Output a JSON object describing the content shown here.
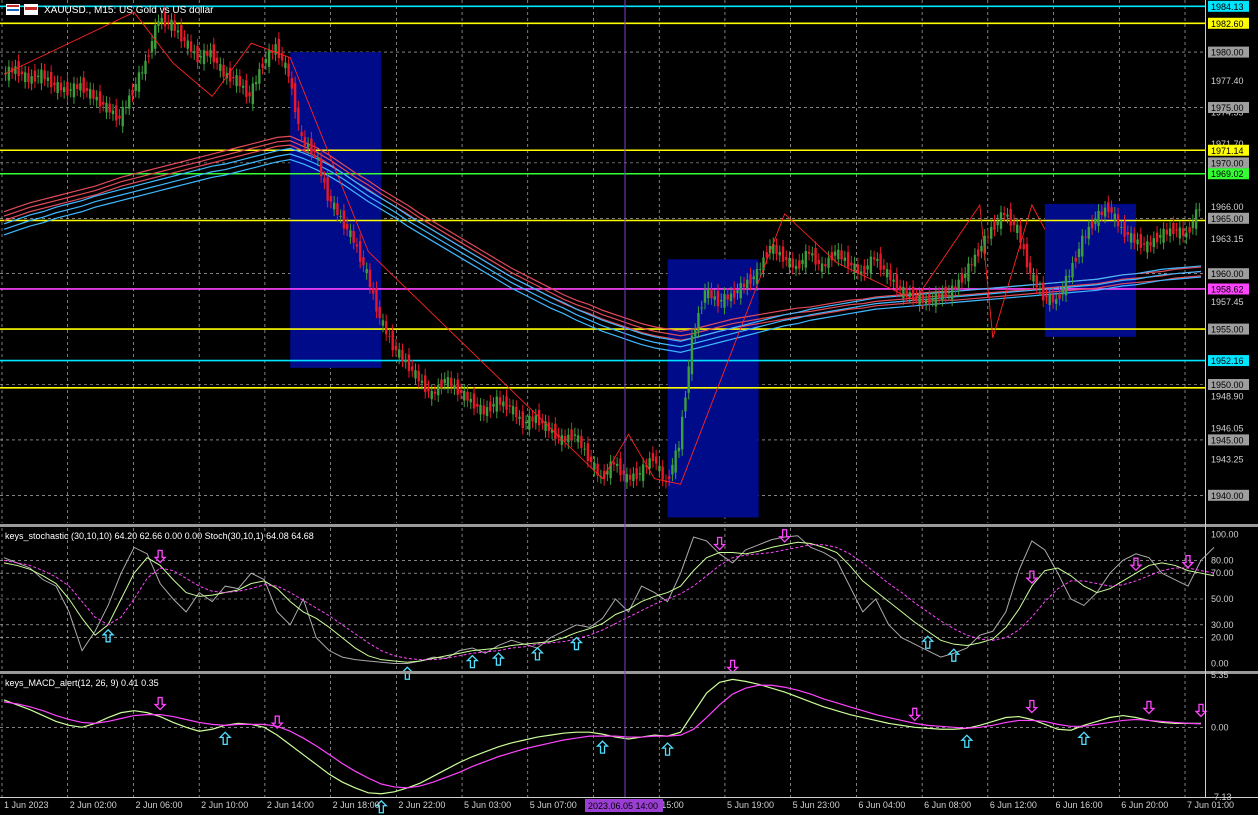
{
  "header": {
    "symbol_title": "XAUUSD., M15: US Gold vs US dollar"
  },
  "chart_data": [
    {
      "type": "candlestick",
      "title": "XAUUSD., M15: US Gold vs US dollar",
      "ylim": [
        1937.5,
        1984.7
      ],
      "price_axis_ticks": [
        "1980.00",
        "1977.40",
        "1975.00",
        "1974.55",
        "1971.70",
        "1970.00",
        "1966.00",
        "1963.15",
        "1960.00",
        "1957.45",
        "1955.00",
        "1948.90",
        "1946.05",
        "1945.00",
        "1943.25",
        "1940.00"
      ],
      "highlighted_levels": [
        {
          "label": "1984.13",
          "value": 1984.13,
          "color": "#00e5ff"
        },
        {
          "label": "1982.60",
          "value": 1982.6,
          "color": "#ffff00"
        },
        {
          "label": "1980.00",
          "value": 1980.0,
          "color": "#9e9e9e"
        },
        {
          "label": "1975.00",
          "value": 1975.0,
          "color": "#9e9e9e"
        },
        {
          "label": "1971.14",
          "value": 1971.14,
          "color": "#ffff00"
        },
        {
          "label": "1970.00",
          "value": 1970.0,
          "color": "#9e9e9e"
        },
        {
          "label": "1969.02",
          "value": 1969.02,
          "color": "#33ff33"
        },
        {
          "label": "1965.00",
          "value": 1965.0,
          "color": "#9e9e9e"
        },
        {
          "label": "1960.00",
          "value": 1960.0,
          "color": "#9e9e9e"
        },
        {
          "label": "1958.62",
          "value": 1958.62,
          "color": "#ff44ff"
        },
        {
          "label": "1955.00",
          "value": 1955.0,
          "color": "#9e9e9e"
        },
        {
          "label": "1952.16",
          "value": 1952.16,
          "color": "#00e5ff"
        },
        {
          "label": "1950.00",
          "value": 1950.0,
          "color": "#9e9e9e"
        },
        {
          "label": "1945.00",
          "value": 1945.0,
          "color": "#9e9e9e"
        },
        {
          "label": "1940.00",
          "value": 1940.0,
          "color": "#9e9e9e"
        }
      ],
      "horizontal_lines": [
        {
          "value": 1984.13,
          "color": "#00e5ff"
        },
        {
          "value": 1982.6,
          "color": "#ffff00"
        },
        {
          "value": 1971.14,
          "color": "#ffff00"
        },
        {
          "value": 1969.02,
          "color": "#33ff33"
        },
        {
          "value": 1964.8,
          "color": "#ffff00"
        },
        {
          "value": 1958.62,
          "color": "#ff44ff"
        },
        {
          "value": 1955.0,
          "color": "#ffff00"
        },
        {
          "value": 1952.16,
          "color": "#00e5ff"
        },
        {
          "value": 1949.7,
          "color": "#ffff00"
        }
      ],
      "highlight_boxes": [
        {
          "from_bar": 22,
          "to_bar": 29,
          "top": 1980.0,
          "bottom": 1951.5
        },
        {
          "from_bar": 51,
          "to_bar": 58,
          "top": 1961.3,
          "bottom": 1938.0
        },
        {
          "from_bar": 80,
          "to_bar": 87,
          "top": 1966.3,
          "bottom": 1954.3
        }
      ],
      "close_path": [
        1978,
        1978.5,
        1977.5,
        1978,
        1977,
        1976.5,
        1977,
        1976,
        1975,
        1974,
        1976.5,
        1979,
        1983,
        1982.5,
        1981,
        1979.5,
        1980,
        1978,
        1977.5,
        1976,
        1979,
        1980.5,
        1978,
        1972,
        1971,
        1967,
        1965,
        1963,
        1960,
        1956,
        1953.5,
        1952,
        1950.5,
        1949,
        1950.5,
        1949.5,
        1948.5,
        1947.5,
        1948.5,
        1948,
        1946.5,
        1947,
        1946,
        1945,
        1945.5,
        1943.5,
        1941.5,
        1943,
        1941.5,
        1942,
        1943.5,
        1941,
        1944.5,
        1954,
        1958.5,
        1957.5,
        1958,
        1959,
        1960,
        1962.5,
        1961.5,
        1960.5,
        1962,
        1960.5,
        1962,
        1961,
        1960,
        1961.5,
        1960,
        1958.5,
        1958,
        1957.5,
        1958,
        1958.5,
        1960,
        1962,
        1964,
        1965.5,
        1964,
        1960,
        1958,
        1957.5,
        1960,
        1963,
        1965,
        1966,
        1964,
        1963,
        1962.5,
        1963.5,
        1964,
        1963.5,
        1966
      ],
      "fast_ma": [
        1965.2,
        1965.6,
        1966,
        1966.3,
        1966.6,
        1966.9,
        1967.2,
        1967.5,
        1967.9,
        1968.3,
        1968.6,
        1968.9,
        1969.2,
        1969.5,
        1969.8,
        1970.1,
        1970.4,
        1970.7,
        1971,
        1971.3,
        1971.6,
        1971.9,
        1972.0,
        1971.5,
        1971.0,
        1970.3,
        1969.5,
        1968.7,
        1968.0,
        1967.2,
        1966.5,
        1965.8,
        1965.0,
        1964.3,
        1963.6,
        1962.9,
        1962.2,
        1961.5,
        1960.8,
        1960.1,
        1959.5,
        1958.9,
        1958.3,
        1957.7,
        1957.2,
        1956.8,
        1956.3,
        1955.9,
        1955.5,
        1955.1,
        1954.8,
        1954.6,
        1954.4,
        1954.6,
        1954.9,
        1955.2,
        1955.5,
        1955.7,
        1955.9,
        1956.1,
        1956.3,
        1956.5,
        1956.6,
        1956.8,
        1957.0,
        1957.2,
        1957.3,
        1957.5,
        1957.6,
        1957.7,
        1957.8,
        1957.9,
        1958.0,
        1958.0,
        1958.1,
        1958.2,
        1958.3,
        1958.4,
        1958.5,
        1958.6,
        1958.7,
        1958.8,
        1958.9,
        1959.0,
        1959.1,
        1959.3,
        1959.5,
        1959.6,
        1959.7,
        1959.8,
        1960.0,
        1960.1,
        1960.2
      ],
      "slow_ma": [
        1964.0,
        1964.4,
        1964.8,
        1965.1,
        1965.5,
        1965.8,
        1966.1,
        1966.5,
        1966.8,
        1967.1,
        1967.4,
        1967.7,
        1968.0,
        1968.3,
        1968.6,
        1968.9,
        1969.2,
        1969.4,
        1969.7,
        1970.0,
        1970.3,
        1970.6,
        1970.8,
        1970.4,
        1969.9,
        1969.3,
        1968.6,
        1967.8,
        1967.0,
        1966.3,
        1965.6,
        1964.8,
        1964.1,
        1963.4,
        1962.7,
        1962.0,
        1961.3,
        1960.6,
        1959.9,
        1959.2,
        1958.6,
        1958.0,
        1957.4,
        1956.9,
        1956.3,
        1955.8,
        1955.3,
        1954.9,
        1954.5,
        1954.1,
        1953.8,
        1953.6,
        1953.4,
        1953.7,
        1954.0,
        1954.3,
        1954.6,
        1954.9,
        1955.2,
        1955.5,
        1955.8,
        1956.0,
        1956.3,
        1956.5,
        1956.7,
        1956.9,
        1957.1,
        1957.3,
        1957.4,
        1957.5,
        1957.6,
        1957.7,
        1957.8,
        1957.9,
        1958.0,
        1958.1,
        1958.2,
        1958.3,
        1958.4,
        1958.5,
        1958.6,
        1958.7,
        1958.8,
        1958.9,
        1959.0,
        1959.2,
        1959.4,
        1959.5,
        1959.7,
        1959.9,
        1960.0,
        1960.1,
        1960.2
      ]
    },
    {
      "type": "line",
      "title": "keys_stochastic (30,10,10) 64.20 62.66 0.00 0.00 Stoch(30,10,1) 64.08 64.68",
      "ylim": [
        -5,
        105
      ],
      "y_ticks": [
        "100.00",
        "80.00",
        "70.00",
        "50.00",
        "30.00",
        "20.00",
        "0.00"
      ],
      "series": [
        {
          "name": "Stoch(30,10,1)",
          "color": "#aaaaaa",
          "values": [
            82,
            78,
            74,
            65,
            60,
            40,
            10,
            25,
            45,
            70,
            90,
            85,
            62,
            50,
            40,
            55,
            48,
            60,
            58,
            70,
            65,
            40,
            30,
            50,
            20,
            10,
            5,
            3,
            2,
            1,
            0,
            0,
            2,
            5,
            4,
            10,
            12,
            8,
            14,
            18,
            15,
            12,
            20,
            25,
            30,
            28,
            35,
            50,
            40,
            60,
            55,
            48,
            70,
            98,
            95,
            85,
            78,
            88,
            92,
            96,
            98,
            99,
            90,
            86,
            80,
            60,
            40,
            50,
            30,
            20,
            15,
            10,
            5,
            8,
            12,
            22,
            25,
            40,
            72,
            95,
            88,
            70,
            50,
            45,
            55,
            70,
            80,
            85,
            82,
            70,
            65,
            60,
            80,
            90
          ]
        },
        {
          "name": "",
          "color": "#ccff99",
          "values": [
            78,
            76,
            73,
            68,
            62,
            50,
            35,
            22,
            30,
            50,
            70,
            82,
            76,
            65,
            55,
            52,
            53,
            55,
            57,
            62,
            64,
            58,
            48,
            40,
            35,
            28,
            20,
            12,
            6,
            3,
            2,
            1,
            2,
            4,
            6,
            8,
            10,
            11,
            12,
            14,
            15,
            16,
            17,
            20,
            24,
            27,
            31,
            38,
            42,
            48,
            52,
            55,
            60,
            72,
            82,
            86,
            86,
            85,
            87,
            90,
            92,
            94,
            93,
            90,
            86,
            76,
            64,
            56,
            48,
            40,
            32,
            25,
            18,
            15,
            14,
            16,
            19,
            28,
            42,
            60,
            72,
            74,
            68,
            60,
            55,
            58,
            64,
            70,
            76,
            78,
            76,
            72,
            70,
            68
          ]
        },
        {
          "name": "",
          "color": "#ff44ff",
          "dashed": true,
          "values": [
            80,
            78,
            76,
            72,
            67,
            60,
            48,
            36,
            30,
            36,
            50,
            66,
            74,
            72,
            66,
            60,
            56,
            55,
            56,
            58,
            61,
            60,
            55,
            49,
            43,
            37,
            30,
            23,
            16,
            10,
            6,
            4,
            3,
            3,
            4,
            6,
            8,
            9,
            10,
            12,
            13,
            15,
            16,
            17,
            19,
            22,
            26,
            31,
            36,
            41,
            46,
            50,
            54,
            60,
            68,
            76,
            82,
            84,
            85,
            86,
            88,
            90,
            92,
            92,
            90,
            85,
            78,
            70,
            62,
            55,
            47,
            40,
            33,
            27,
            22,
            19,
            18,
            20,
            26,
            36,
            48,
            58,
            64,
            64,
            62,
            60,
            61,
            64,
            68,
            72,
            74,
            74,
            72,
            70
          ]
        }
      ]
    },
    {
      "type": "line",
      "title": "keys_MACD_alert(12, 26, 9) 0.41 0.35",
      "ylim": [
        -7.13,
        5.35
      ],
      "y_ticks": [
        "5.35",
        "0.00",
        "-7.13"
      ],
      "series": [
        {
          "name": "",
          "color": "#ccff99",
          "values": [
            2.8,
            2.3,
            1.8,
            1.2,
            0.6,
            0.2,
            0.0,
            0.4,
            1.0,
            1.5,
            1.7,
            1.5,
            1.1,
            0.5,
            0.0,
            -0.4,
            -0.2,
            0.2,
            0.4,
            0.3,
            0.0,
            -0.8,
            -1.8,
            -2.8,
            -3.8,
            -4.8,
            -5.6,
            -6.2,
            -6.7,
            -6.8,
            -6.6,
            -6.2,
            -5.7,
            -5.0,
            -4.3,
            -3.6,
            -3.0,
            -2.5,
            -2.0,
            -1.6,
            -1.3,
            -1.0,
            -0.8,
            -0.6,
            -0.5,
            -0.5,
            -0.7,
            -1.0,
            -1.2,
            -1.0,
            -0.8,
            -0.9,
            -0.5,
            1.5,
            3.5,
            4.6,
            4.9,
            4.7,
            4.4,
            4.0,
            3.6,
            3.1,
            2.6,
            2.1,
            1.7,
            1.3,
            1.0,
            0.7,
            0.4,
            0.2,
            0.0,
            -0.1,
            -0.2,
            -0.2,
            -0.1,
            0.2,
            0.6,
            1.0,
            1.1,
            0.8,
            0.3,
            -0.2,
            -0.3,
            0.2,
            0.6,
            1.0,
            1.2,
            1.0,
            0.7,
            0.5,
            0.4,
            0.4,
            0.4
          ]
        },
        {
          "name": "",
          "color": "#ff44ff",
          "values": [
            2.6,
            2.4,
            2.1,
            1.7,
            1.2,
            0.8,
            0.5,
            0.4,
            0.6,
            0.9,
            1.2,
            1.3,
            1.3,
            1.1,
            0.8,
            0.5,
            0.3,
            0.2,
            0.3,
            0.3,
            0.3,
            0.1,
            -0.4,
            -1.1,
            -1.9,
            -2.8,
            -3.7,
            -4.5,
            -5.2,
            -5.8,
            -6.1,
            -6.2,
            -6.0,
            -5.6,
            -5.1,
            -4.6,
            -4.0,
            -3.5,
            -3.0,
            -2.6,
            -2.2,
            -1.9,
            -1.6,
            -1.3,
            -1.1,
            -0.9,
            -0.9,
            -0.9,
            -1.0,
            -1.0,
            -0.9,
            -0.9,
            -0.8,
            -0.2,
            1.0,
            2.3,
            3.4,
            4.0,
            4.3,
            4.3,
            4.1,
            3.8,
            3.4,
            2.9,
            2.5,
            2.1,
            1.7,
            1.3,
            1.0,
            0.7,
            0.4,
            0.2,
            0.1,
            0.0,
            -0.1,
            0.0,
            0.2,
            0.5,
            0.7,
            0.7,
            0.6,
            0.3,
            0.1,
            0.1,
            0.3,
            0.5,
            0.7,
            0.8,
            0.7,
            0.6,
            0.5,
            0.4,
            0.35
          ]
        }
      ]
    }
  ],
  "stoch_arrows": [
    {
      "dir": "up",
      "bar": 8
    },
    {
      "dir": "down",
      "bar": 12
    },
    {
      "dir": "up",
      "bar": 31
    },
    {
      "dir": "up",
      "bar": 36
    },
    {
      "dir": "up",
      "bar": 38
    },
    {
      "dir": "up",
      "bar": 41
    },
    {
      "dir": "up",
      "bar": 44
    },
    {
      "dir": "down",
      "bar": 55
    },
    {
      "dir": "down",
      "bar": 60
    },
    {
      "dir": "up",
      "bar": 71
    },
    {
      "dir": "up",
      "bar": 73
    },
    {
      "dir": "down",
      "bar": 79
    },
    {
      "dir": "down",
      "bar": 87
    },
    {
      "dir": "down",
      "bar": 91
    }
  ],
  "macd_arrows": [
    {
      "dir": "down",
      "bar": 12
    },
    {
      "dir": "up",
      "bar": 17
    },
    {
      "dir": "down",
      "bar": 21
    },
    {
      "dir": "up",
      "bar": 29
    },
    {
      "dir": "up",
      "bar": 46
    },
    {
      "dir": "up",
      "bar": 51
    },
    {
      "dir": "down",
      "bar": 56
    },
    {
      "dir": "down",
      "bar": 70
    },
    {
      "dir": "up",
      "bar": 74
    },
    {
      "dir": "down",
      "bar": 79
    },
    {
      "dir": "up",
      "bar": 83
    },
    {
      "dir": "down",
      "bar": 88
    },
    {
      "dir": "down",
      "bar": 92
    }
  ],
  "time_axis": {
    "labels": [
      "1 Jun 2023",
      "2 Jun 02:00",
      "2 Jun 06:00",
      "2 Jun 10:00",
      "2 Jun 14:00",
      "2 Jun 18:00",
      "2 Jun 22:00",
      "5 Jun 03:00",
      "5 Jun 07:00",
      "5",
      "15:00",
      "5 Jun 19:00",
      "5 Jun 23:00",
      "6 Jun 04:00",
      "6 Jun 08:00",
      "6 Jun 12:00",
      "6 Jun 16:00",
      "6 Jun 20:00",
      "7 Jun 01:00"
    ],
    "crosshair_label": "2023.06.05 14:00"
  },
  "colors": {
    "bull": "#3c9e3c",
    "bear": "#e8182a",
    "grid": "#d0d0d0",
    "box": "#000b8a",
    "zigzag": "#ff2222",
    "ma_red": "#e04a5a",
    "ma_blue": "#3fb8ff",
    "crosshair": "#7a3fc8",
    "crosshair_label_bg": "#9b3fd4"
  }
}
